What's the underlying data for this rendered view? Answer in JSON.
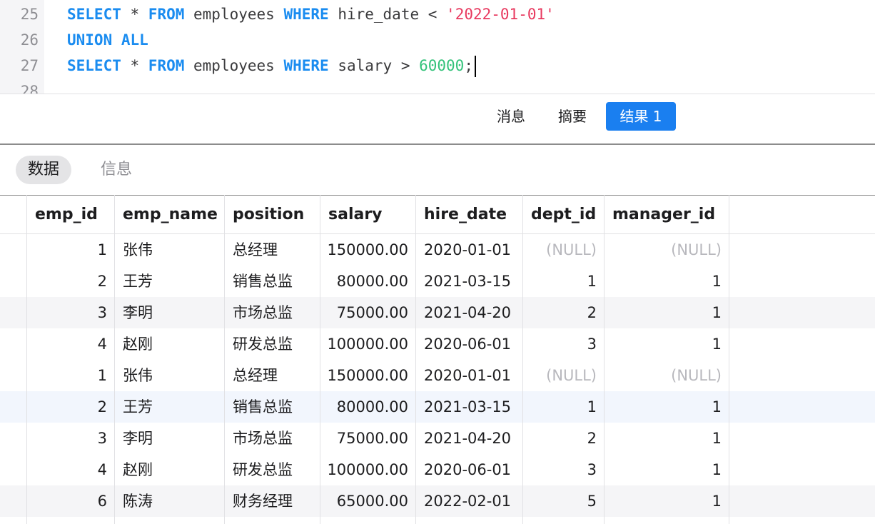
{
  "editor": {
    "lines": [
      {
        "num": "25",
        "tokens": [
          {
            "t": "kw",
            "v": "SELECT"
          },
          {
            "t": "plain",
            "v": " * "
          },
          {
            "t": "kw",
            "v": "FROM"
          },
          {
            "t": "plain",
            "v": " employees "
          },
          {
            "t": "kw",
            "v": "WHERE"
          },
          {
            "t": "plain",
            "v": " hire_date < "
          },
          {
            "t": "str",
            "v": "'2022-01-01'"
          }
        ]
      },
      {
        "num": "26",
        "tokens": [
          {
            "t": "kw",
            "v": "UNION ALL"
          }
        ]
      },
      {
        "num": "27",
        "tokens": [
          {
            "t": "kw",
            "v": "SELECT"
          },
          {
            "t": "plain",
            "v": " * "
          },
          {
            "t": "kw",
            "v": "FROM"
          },
          {
            "t": "plain",
            "v": " employees "
          },
          {
            "t": "kw",
            "v": "WHERE"
          },
          {
            "t": "plain",
            "v": " salary > "
          },
          {
            "t": "num",
            "v": "60000"
          },
          {
            "t": "plain",
            "v": ";"
          }
        ],
        "caret": true
      },
      {
        "num": "28",
        "tokens": []
      }
    ]
  },
  "result_tabs": {
    "messages": "消息",
    "summary": "摘要",
    "result1": "结果 1"
  },
  "segments": {
    "data": "数据",
    "info": "信息"
  },
  "grid": {
    "columns": [
      "emp_id",
      "emp_name",
      "position",
      "salary",
      "hire_date",
      "dept_id",
      "manager_id"
    ],
    "rows": [
      [
        "1",
        "张伟",
        "总经理",
        "150000.00",
        "2020-01-01",
        "(NULL)",
        "(NULL)"
      ],
      [
        "2",
        "王芳",
        "销售总监",
        "80000.00",
        "2021-03-15",
        "1",
        "1"
      ],
      [
        "3",
        "李明",
        "市场总监",
        "75000.00",
        "2021-04-20",
        "2",
        "1"
      ],
      [
        "4",
        "赵刚",
        "研发总监",
        "100000.00",
        "2020-06-01",
        "3",
        "1"
      ],
      [
        "1",
        "张伟",
        "总经理",
        "150000.00",
        "2020-01-01",
        "(NULL)",
        "(NULL)"
      ],
      [
        "2",
        "王芳",
        "销售总监",
        "80000.00",
        "2021-03-15",
        "1",
        "1"
      ],
      [
        "3",
        "李明",
        "市场总监",
        "75000.00",
        "2021-04-20",
        "2",
        "1"
      ],
      [
        "4",
        "赵刚",
        "研发总监",
        "100000.00",
        "2020-06-01",
        "3",
        "1"
      ],
      [
        "6",
        "陈涛",
        "财务经理",
        "65000.00",
        "2022-02-01",
        "5",
        "1"
      ]
    ],
    "row_styles": [
      "",
      "",
      "alt",
      "",
      "",
      "sel",
      "",
      "",
      "alt"
    ]
  },
  "colors": {
    "keyword": "#1a8cf0",
    "string": "#e8395f",
    "number": "#33c27a",
    "accent": "#1a7ff0",
    "null_text": "#b8b8bd"
  }
}
